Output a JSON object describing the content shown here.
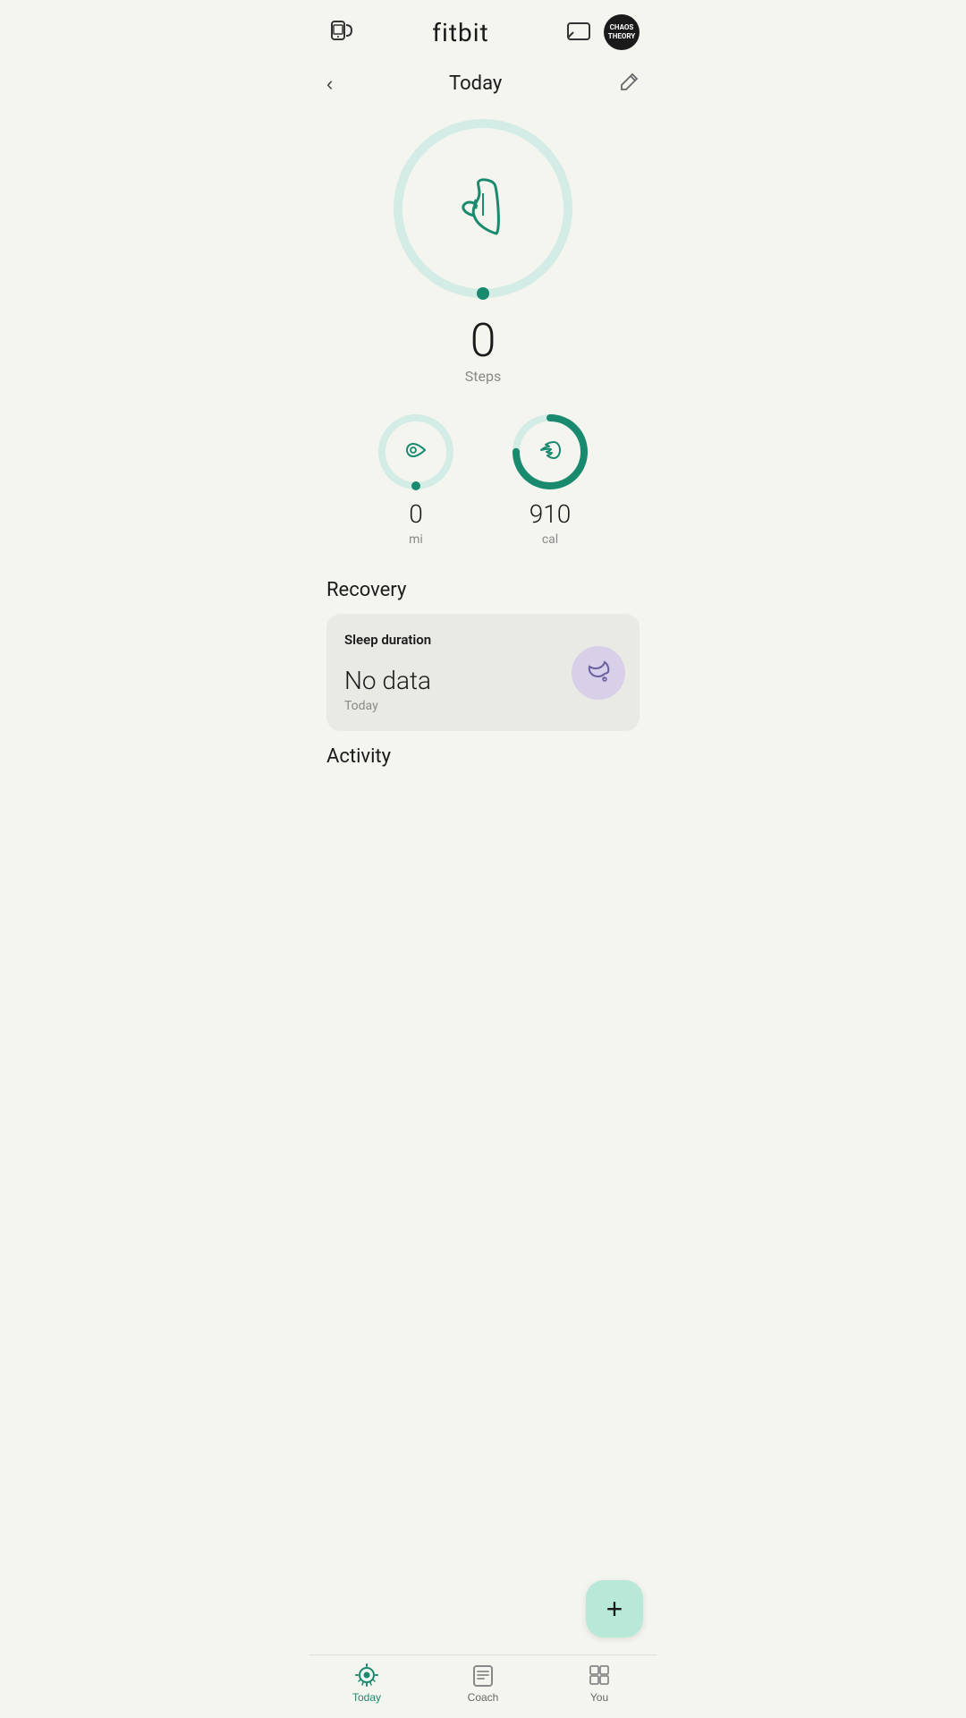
{
  "app": {
    "title": "fitbit"
  },
  "header": {
    "device_icon": "device-icon",
    "message_icon": "message-icon",
    "avatar_text": "CHAOS\nTHEORY"
  },
  "sub_header": {
    "back_label": "‹",
    "date": "Today",
    "edit_icon": "edit-icon"
  },
  "steps": {
    "value": "0",
    "label": "Steps",
    "progress": 5
  },
  "stats": [
    {
      "id": "distance",
      "value": "0",
      "unit": "mi",
      "icon": "location-icon",
      "progress": 5
    },
    {
      "id": "calories",
      "value": "910",
      "unit": "cal",
      "icon": "flame-icon",
      "progress": 75
    }
  ],
  "recovery": {
    "section_title": "Recovery",
    "card": {
      "title": "Sleep duration",
      "no_data_text": "No data",
      "sub_text": "Today",
      "icon": "moon-icon"
    }
  },
  "activity": {
    "section_title": "Activity"
  },
  "fab": {
    "label": "+"
  },
  "nav": {
    "items": [
      {
        "id": "today",
        "label": "Today",
        "active": true
      },
      {
        "id": "coach",
        "label": "Coach",
        "active": false
      },
      {
        "id": "you",
        "label": "You",
        "active": false
      }
    ]
  },
  "colors": {
    "teal": "#1a8a6e",
    "teal_light": "#c8e8e0",
    "ring_bg": "#d4ece6",
    "fab_bg": "#b8e8d8",
    "card_bg": "#eaeae5",
    "moon_bg": "#d8d0e8"
  }
}
